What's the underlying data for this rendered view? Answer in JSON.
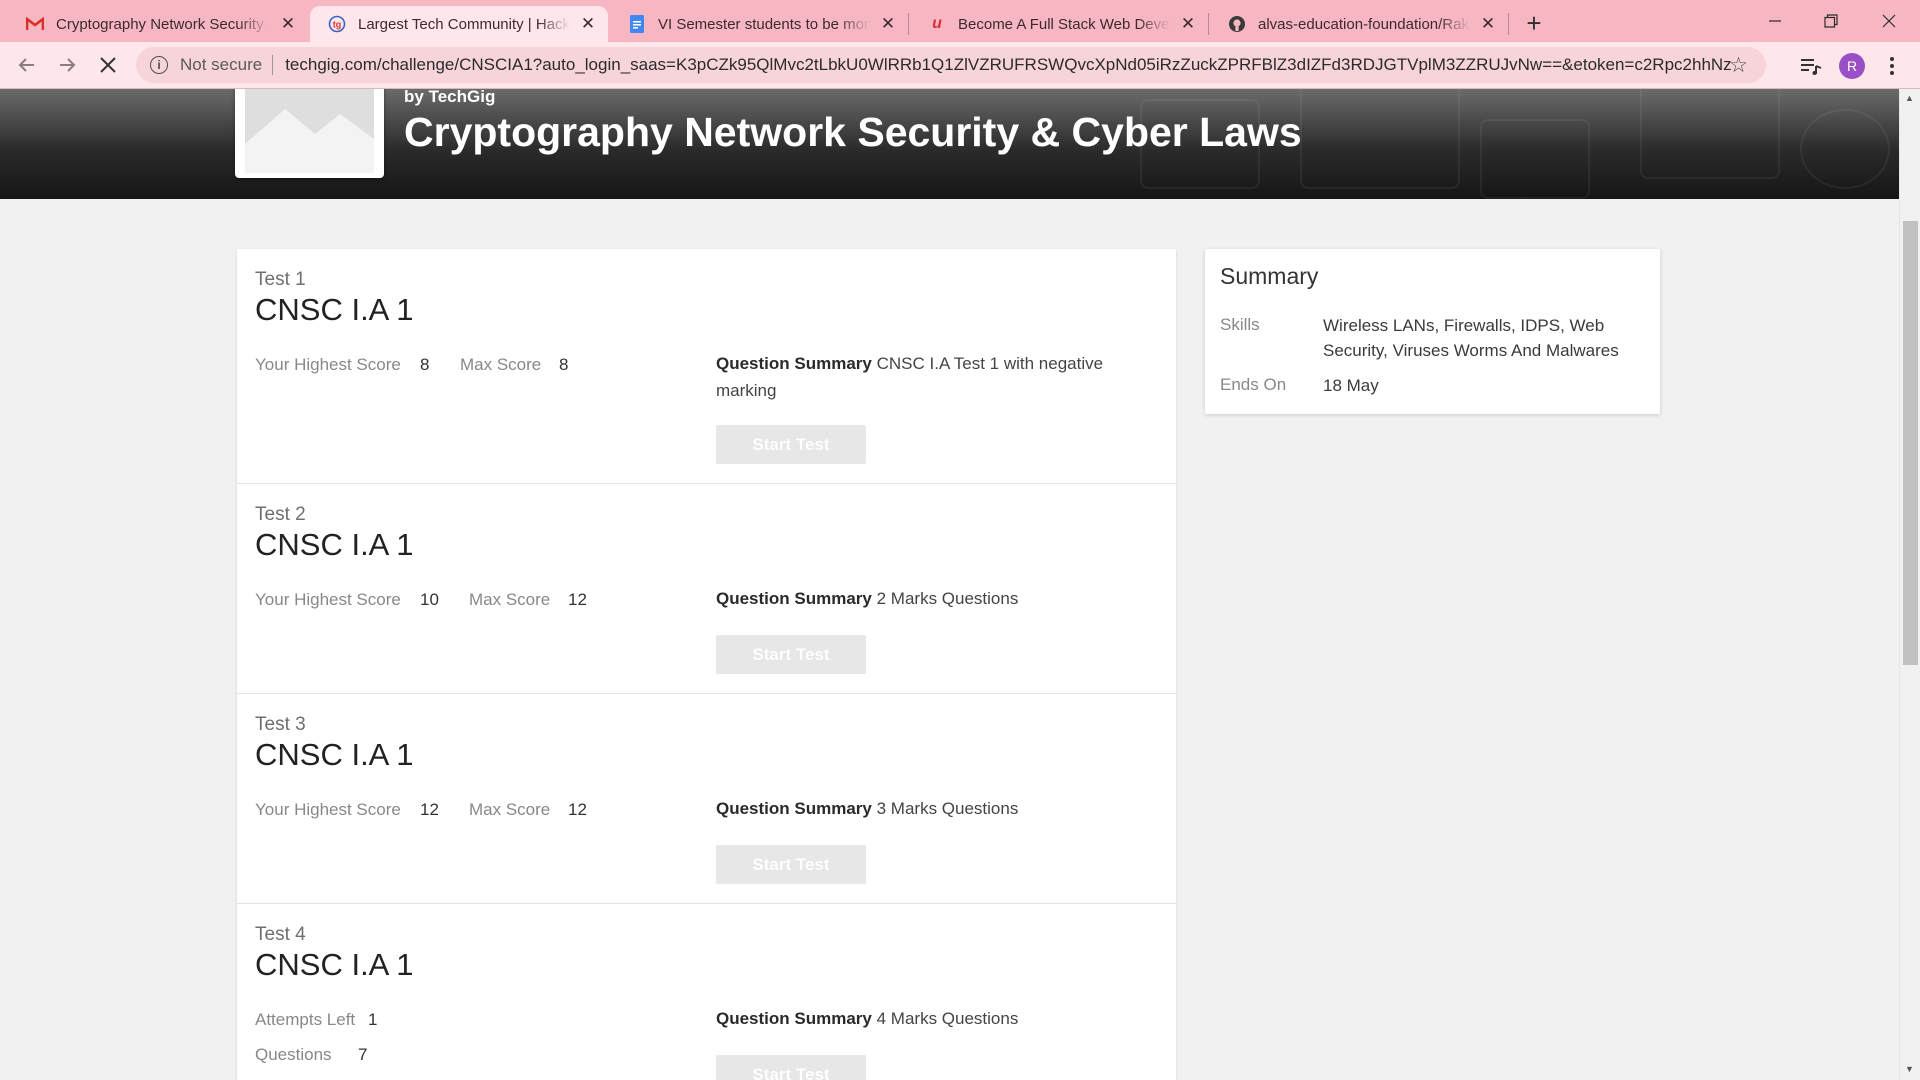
{
  "browser": {
    "tabs": [
      {
        "title": "Cryptography Network Security & Cyber Laws",
        "icon": "gmail-icon",
        "active": false
      },
      {
        "title": "Largest Tech Community | Hackathons",
        "icon": "techgig-icon",
        "active": true
      },
      {
        "title": "VI Semester students to be monitored",
        "icon": "docs-icon",
        "active": false
      },
      {
        "title": "Become A Full Stack Web Developer",
        "icon": "udemy-icon",
        "active": false
      },
      {
        "title": "alvas-education-foundation/Raksha",
        "icon": "github-icon",
        "active": false
      }
    ],
    "newtab_label": "+",
    "address": {
      "security_label": "Not secure",
      "url": "techgig.com/challenge/CNSCIA1?auto_login_saas=K3pCZk95QlMvc2tLbkU0WlRRb1Q1ZlVZRUFRSWQvcXpNd05iRzZuckZPRFBlZ3dIZFd3RDJGTVplM3ZZRUJvNw==&etoken=c2Rpc2hhNz..."
    },
    "avatar_initial": "R",
    "colors": {
      "tabstrip": "#f6b6c2",
      "toolbar": "#fde7eb"
    }
  },
  "banner": {
    "by_prefix": "by",
    "by_brand": "TechGig",
    "title": "Cryptography Network Security & Cyber Laws"
  },
  "tests": [
    {
      "label": "Test 1",
      "name": "CNSC I.A 1",
      "stats": [
        {
          "label": "Your Highest Score",
          "value": "8"
        },
        {
          "label": "Max Score",
          "value": "8"
        }
      ],
      "question_summary_label": "Question Summary",
      "question_summary": "CNSC I.A Test 1 with negative marking",
      "button": "Start Test"
    },
    {
      "label": "Test 2",
      "name": "CNSC I.A 1",
      "stats": [
        {
          "label": "Your Highest Score",
          "value": "10"
        },
        {
          "label": "Max Score",
          "value": "12"
        }
      ],
      "question_summary_label": "Question Summary",
      "question_summary": "2 Marks Questions",
      "button": "Start Test"
    },
    {
      "label": "Test 3",
      "name": "CNSC I.A 1",
      "stats": [
        {
          "label": "Your Highest Score",
          "value": "12"
        },
        {
          "label": "Max Score",
          "value": "12"
        }
      ],
      "question_summary_label": "Question Summary",
      "question_summary": "3 Marks Questions",
      "button": "Start Test"
    },
    {
      "label": "Test 4",
      "name": "CNSC I.A 1",
      "stats": [
        {
          "label": "Attempts Left",
          "value": "1"
        },
        {
          "label": "Questions",
          "value": "7"
        }
      ],
      "question_summary_label": "Question Summary",
      "question_summary": "4 Marks Questions",
      "button": "Start Test"
    }
  ],
  "summary": {
    "title": "Summary",
    "skills_label": "Skills",
    "skills": "Wireless LANs, Firewalls, IDPS, Web Security, Viruses Worms And Malwares",
    "ends_label": "Ends On",
    "ends_value": "18 May"
  }
}
